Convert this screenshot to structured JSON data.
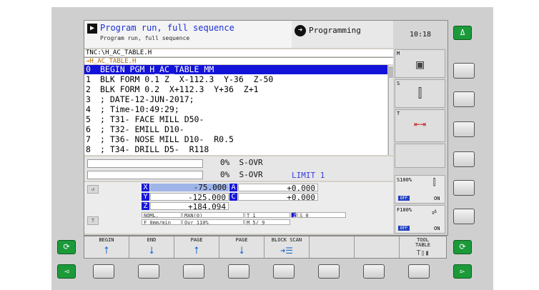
{
  "header": {
    "mode_title": "Program run, full sequence",
    "mode_subtitle": "Program run, full sequence",
    "secondary_mode": "Programming",
    "clock": "10:18"
  },
  "file": {
    "path": "TNC:\\H_AC_TABLE.H",
    "tab": "→H_AC_TABLE.H"
  },
  "program_lines": [
    {
      "no": "0",
      "text": "BEGIN PGM H_AC_TABLE MM",
      "selected": true
    },
    {
      "no": "1",
      "text": "BLK FORM 0.1 Z  X-112.3  Y-36  Z-50"
    },
    {
      "no": "2",
      "text": "BLK FORM 0.2  X+112.3  Y+36  Z+1"
    },
    {
      "no": "3",
      "text": "; DATE-12-JUN-2017;"
    },
    {
      "no": "4",
      "text": "; Time-10:49:29;"
    },
    {
      "no": "5",
      "text": "; T31- FACE MILL D50-"
    },
    {
      "no": "6",
      "text": "; T32- EMILL D10-"
    },
    {
      "no": "7",
      "text": "; T36- NOSE MILL D10-  R0.5"
    },
    {
      "no": "8",
      "text": "; T34- DRILL D5-  R118"
    }
  ],
  "overrides": {
    "feed": "0%  S-OVR",
    "spindle": "0%  S-OVR",
    "limit": "LIMIT 1"
  },
  "positions": {
    "x": {
      "label": "X",
      "value": "-75.000"
    },
    "y": {
      "label": "Y",
      "value": "-125.000"
    },
    "z": {
      "label": "Z",
      "value": "+184.094"
    },
    "a": {
      "label": "A",
      "value": "+0.000"
    },
    "c": {
      "label": "C",
      "value": "+0.000"
    }
  },
  "status": {
    "mode": "NOML.",
    "man": "MAN(0)",
    "tool": "T 1",
    "spindle_z": "Z",
    "spindle_s": "S   0",
    "feed": "F  0mm/min",
    "ovr": "Ovr  110%",
    "m": "M  5/ 9"
  },
  "right_panel": {
    "m_tag": "M",
    "s_tag": "S",
    "t_tag": "T",
    "s100": "S100%",
    "f100": "F100%",
    "off": "OFF",
    "on": "ON"
  },
  "softkeys": {
    "begin": "BEGIN",
    "end": "END",
    "page_up": "PAGE",
    "page_down": "PAGE",
    "block_scan": "BLOCK SCAN",
    "tool_table": "TOOL\nTABLE"
  },
  "hardkeys": {
    "top_right": "Δ",
    "left_rotate": "⟳",
    "right_rotate": "⟳",
    "left_arrow": "◅",
    "right_arrow": "▻"
  }
}
